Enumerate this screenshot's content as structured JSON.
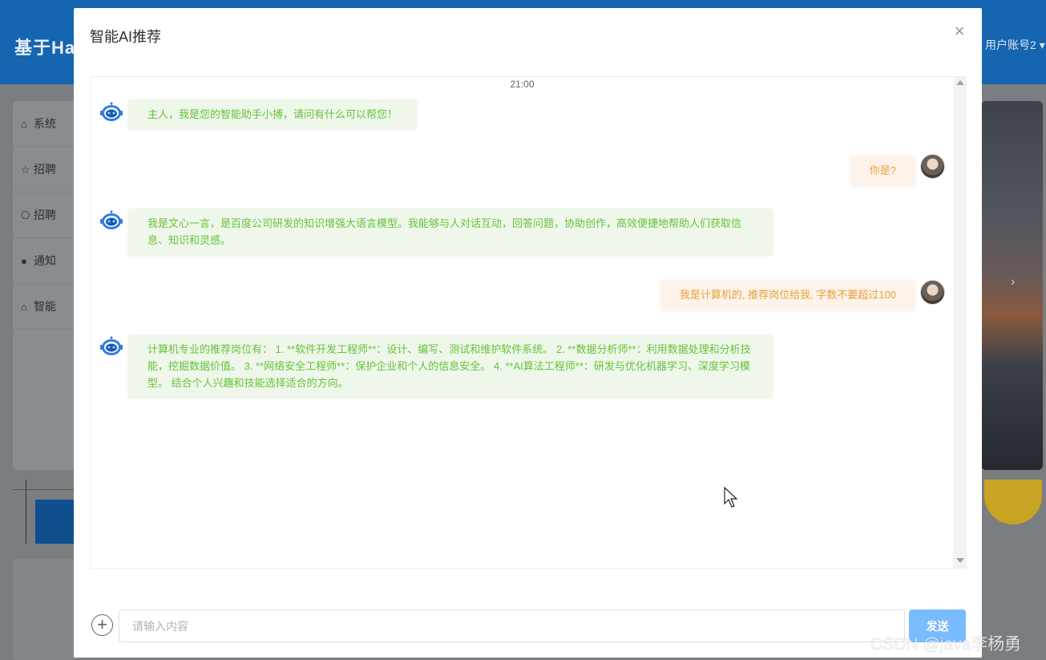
{
  "background": {
    "title": "基于Ha",
    "user_account": "用户账号2",
    "sidebar_items": [
      {
        "icon": "home-icon",
        "label": "系统"
      },
      {
        "icon": "star-icon",
        "label": "招聘"
      },
      {
        "icon": "bag-icon",
        "label": "招聘"
      },
      {
        "icon": "info-icon",
        "label": "通知"
      },
      {
        "icon": "home-icon",
        "label": "智能"
      }
    ]
  },
  "dialog": {
    "title": "智能AI推荐",
    "close_icon": "×",
    "chat": {
      "timestamp": "21:00",
      "messages": [
        {
          "role": "bot",
          "text": "主人，我是您的智能助手小搏，请问有什么可以帮您！"
        },
        {
          "role": "user",
          "text": "你是?"
        },
        {
          "role": "bot",
          "text": "我是文心一言，是百度公司研发的知识增强大语言模型。我能够与人对话互动，回答问题，协助创作，高效便捷地帮助人们获取信息、知识和灵感。"
        },
        {
          "role": "user",
          "text": "我是计算机的, 推荐岗位给我, 字数不要超过100"
        },
        {
          "role": "bot",
          "text": "计算机专业的推荐岗位有： 1. **软件开发工程师**：设计、编写、测试和维护软件系统。 2. **数据分析师**：利用数据处理和分析技能，挖掘数据价值。 3. **网络安全工程师**：保护企业和个人的信息安全。 4. **AI算法工程师**：研发与优化机器学习、深度学习模型。 结合个人兴趣和技能选择适合的方向。"
        }
      ]
    },
    "input": {
      "placeholder": "请输入内容",
      "value": ""
    },
    "send_label": "发送",
    "plus_icon": "+"
  },
  "watermark": "CSDN @java李杨勇",
  "colors": {
    "bot_bubble_bg": "#eef7ea",
    "bot_text": "#67c23a",
    "user_bubble_bg": "#fdf3ea",
    "user_text": "#e6a23c",
    "send_button": "#79bbff",
    "header": "#1565b0"
  }
}
